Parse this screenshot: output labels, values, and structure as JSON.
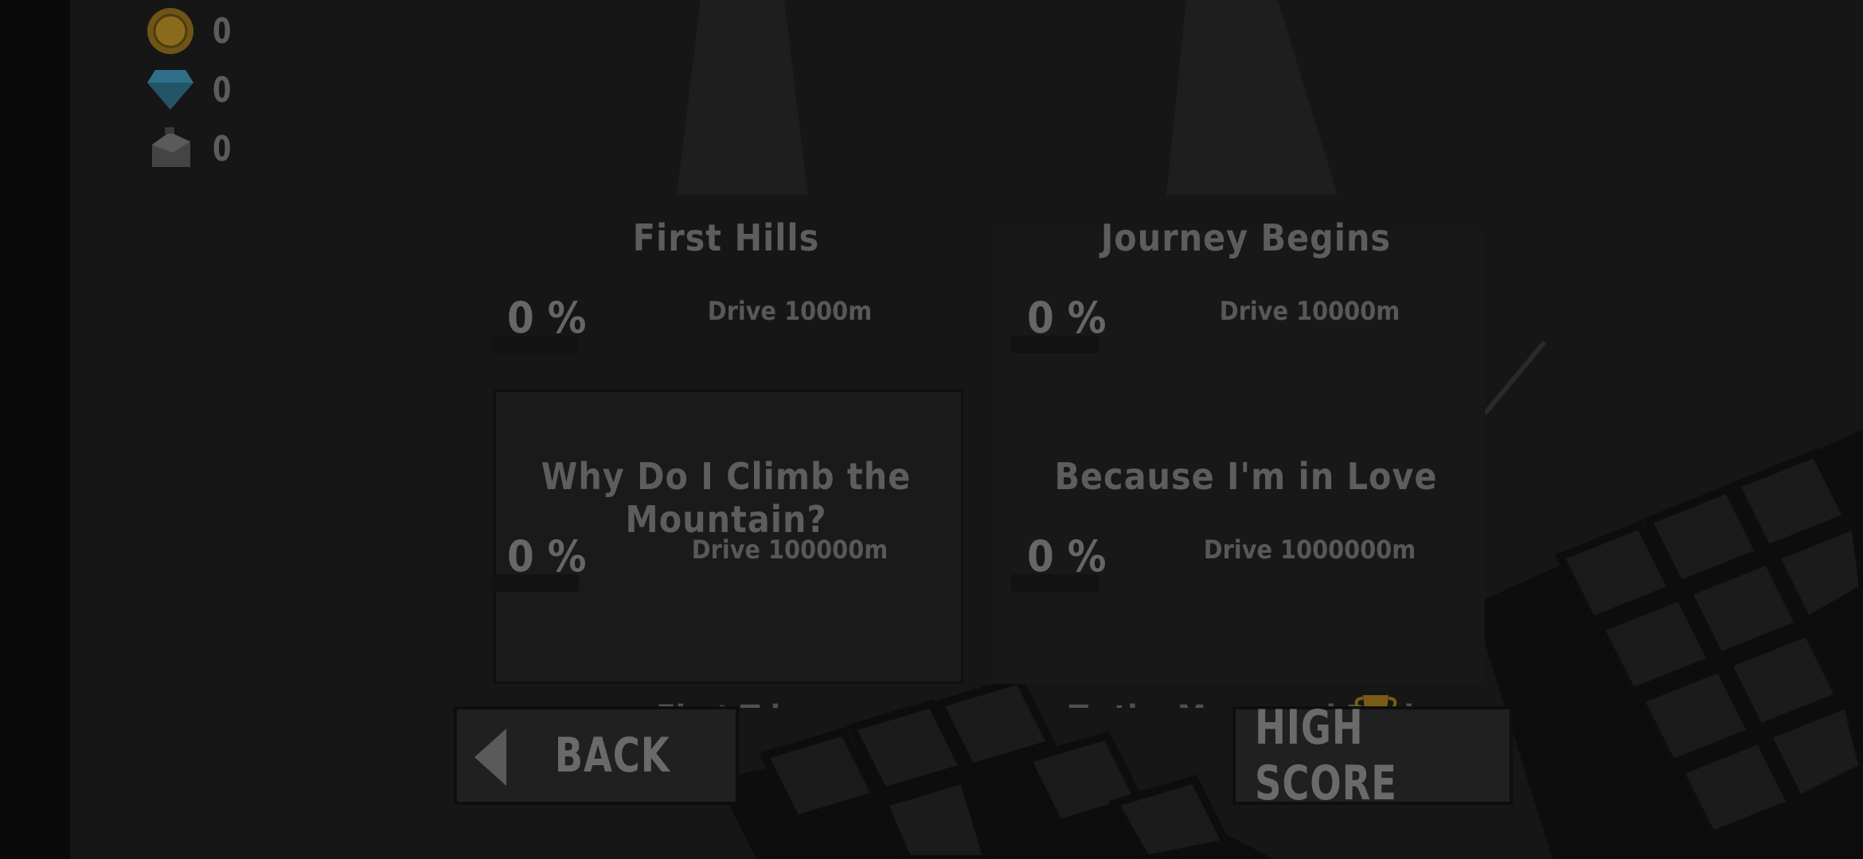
{
  "resources": [
    {
      "icon": "coin-icon",
      "value": "0"
    },
    {
      "icon": "diamond-icon",
      "value": "0"
    },
    {
      "icon": "fuel-can-icon",
      "value": "0"
    }
  ],
  "achievements": [
    {
      "title": "First Hills",
      "progress": "0 %",
      "goal": "Drive 1000m"
    },
    {
      "title": "Journey Begins",
      "progress": "0 %",
      "goal": "Drive 10000m"
    },
    {
      "title": "Why Do I Climb the Mountain?",
      "progress": "0 %",
      "goal": "Drive 100000m"
    },
    {
      "title": "Because I'm in Love",
      "progress": "0 %",
      "goal": "Drive 1000000m"
    }
  ],
  "partial_cards": [
    {
      "title": "First Trip"
    },
    {
      "title": "To the Moon and Back"
    }
  ],
  "buttons": {
    "back": "BACK",
    "high_score": "HIGH SCORE"
  },
  "colors": {
    "background": "#161616",
    "text": "#5f5f5f",
    "coin": "#8a6a1c",
    "diamond": "#2f6f8a",
    "trophy": "#8a6a1c"
  }
}
